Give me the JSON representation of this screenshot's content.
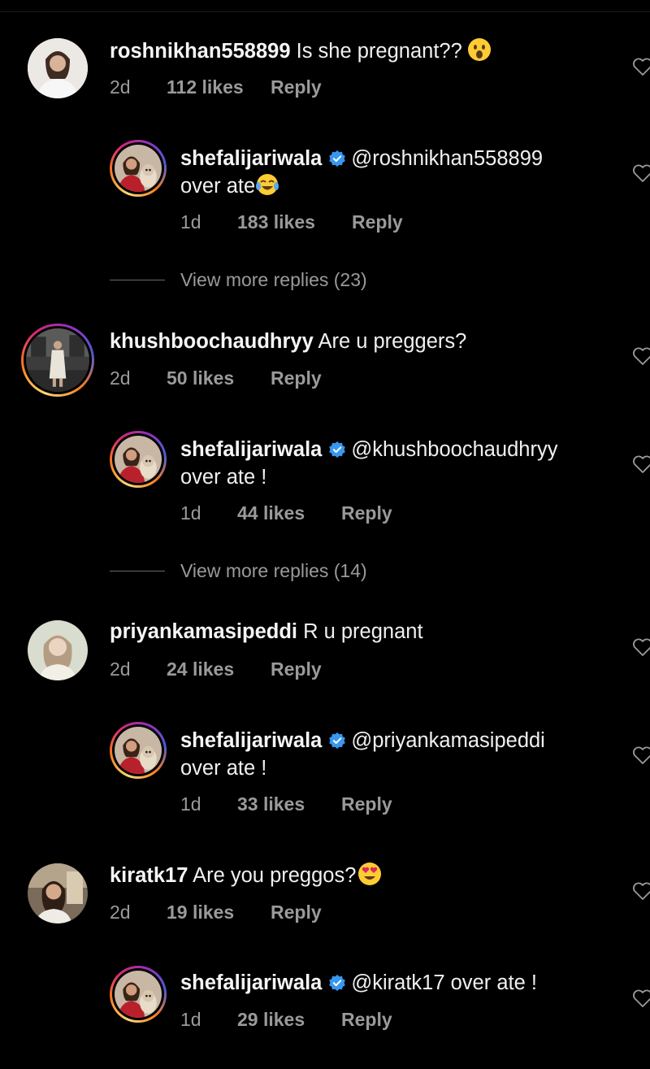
{
  "comments": [
    {
      "username": "roshnikhan558899",
      "text": "Is she pregnant??",
      "emoji": "astonished-face-emoji",
      "time": "2d",
      "likes": "112 likes",
      "reply_label": "Reply",
      "reply": {
        "username": "shefalijariwala",
        "verified": true,
        "mention": "@roshnikhan558899",
        "text": "over ate",
        "emoji": "tears-of-joy-emoji",
        "time": "1d",
        "likes": "183 likes",
        "reply_label": "Reply"
      },
      "view_more": "View more replies (23)"
    },
    {
      "username": "khushboochaudhryy",
      "text": "Are u preggers?",
      "time": "2d",
      "likes": "50 likes",
      "reply_label": "Reply",
      "reply": {
        "username": "shefalijariwala",
        "verified": true,
        "mention": "@khushboochaudhryy",
        "text": "over ate !",
        "time": "1d",
        "likes": "44 likes",
        "reply_label": "Reply"
      },
      "view_more": "View more replies (14)"
    },
    {
      "username": "priyankamasipeddi",
      "text": "R u pregnant",
      "time": "2d",
      "likes": "24 likes",
      "reply_label": "Reply",
      "reply": {
        "username": "shefalijariwala",
        "verified": true,
        "mention": "@priyankamasipeddi",
        "text": "over ate !",
        "time": "1d",
        "likes": "33 likes",
        "reply_label": "Reply"
      }
    },
    {
      "username": "kiratk17",
      "text": "Are you preggos?",
      "emoji": "heart-eyes-emoji",
      "time": "2d",
      "likes": "19 likes",
      "reply_label": "Reply",
      "reply": {
        "username": "shefalijariwala",
        "verified": true,
        "mention": "@kiratk17",
        "text": "over ate !",
        "time": "1d",
        "likes": "29 likes",
        "reply_label": "Reply"
      }
    }
  ],
  "colors": {
    "background": "#000000",
    "text": "#f0f0f0",
    "meta": "#9a9a9a",
    "verified": "#3897f0"
  }
}
